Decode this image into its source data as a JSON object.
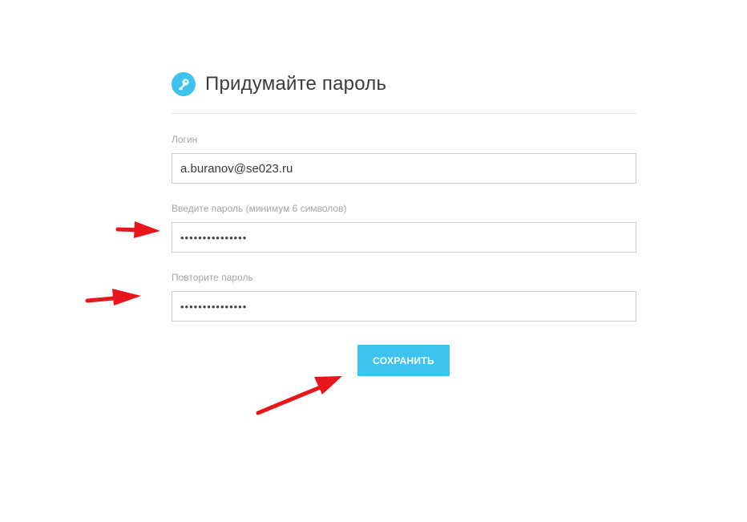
{
  "page_title": "Придумайте пароль",
  "icons": {
    "header": "key-icon"
  },
  "colors": {
    "accent": "#3ec3ef",
    "annotation_arrow": "#e8161b"
  },
  "form": {
    "login": {
      "label": "Логин",
      "value": "a.buranov@se023.ru"
    },
    "password": {
      "label": "Введите пароль (минимум 6 символов)",
      "value": "•••••••••••••••"
    },
    "password_repeat": {
      "label": "Повторите пароль",
      "value": "•••••••••••••••"
    },
    "save_label": "СОХРАНИТЬ"
  }
}
